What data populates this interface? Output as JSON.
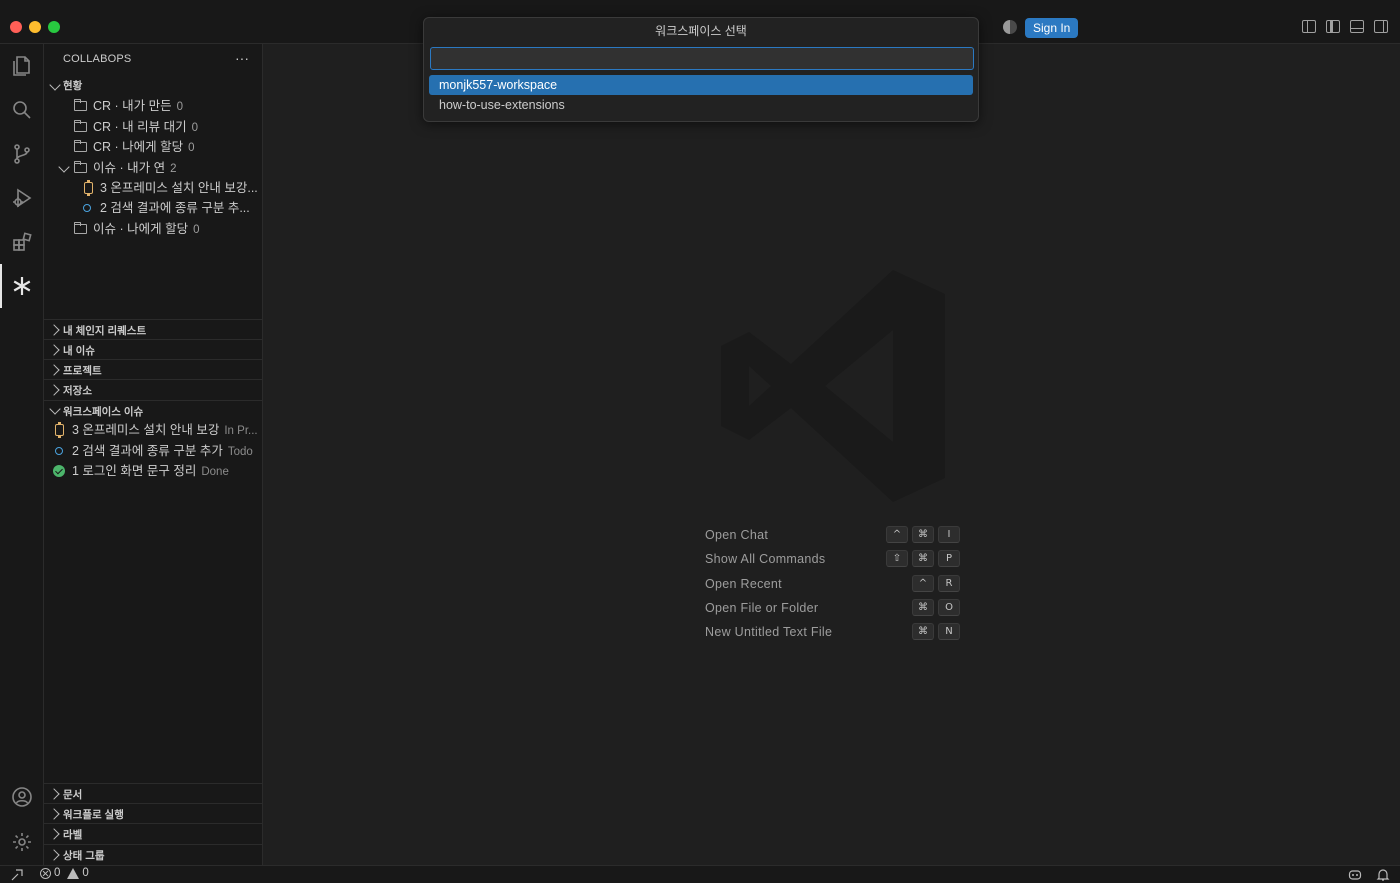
{
  "titlebar": {
    "sign_in_label": "Sign In"
  },
  "activity_bar": {
    "items": [
      {
        "icon": "files-icon"
      },
      {
        "icon": "search-icon"
      },
      {
        "icon": "source-control-icon"
      },
      {
        "icon": "run-debug-icon"
      },
      {
        "icon": "extensions-icon"
      },
      {
        "icon": "collabops-asterisk-icon",
        "active": true
      }
    ],
    "bottom": [
      {
        "icon": "account-icon"
      },
      {
        "icon": "gear-icon"
      }
    ]
  },
  "sidebar": {
    "title": "COLLABOPS",
    "more": "···",
    "status_group": {
      "title": "현황",
      "items": [
        {
          "label": "CR · 내가 만든",
          "count": "0"
        },
        {
          "label": "CR · 내 리뷰 대기",
          "count": "0"
        },
        {
          "label": "CR · 나에게 할당",
          "count": "0"
        },
        {
          "label": "이슈 · 내가 연",
          "count": "2"
        },
        {
          "label": "3  온프레미스 설치 안내 보강..."
        },
        {
          "label": "2  검색 결과에 종류 구분 추..."
        },
        {
          "label": "이슈 · 나에게 할당",
          "count": "0"
        }
      ]
    },
    "sections": [
      {
        "title": "내 체인지 리퀘스트"
      },
      {
        "title": "내 이슈"
      },
      {
        "title": "프로젝트"
      },
      {
        "title": "저장소"
      },
      {
        "title": "워크스페이스 이슈"
      }
    ],
    "workspace_issues": [
      {
        "label": "3  온프레미스 설치 안내 보강",
        "state": "In Pr..."
      },
      {
        "label": "2  검색 결과에 종류 구분 추가",
        "state": "Todo"
      },
      {
        "label": "1  로그인 화면 문구 정리",
        "state": "Done"
      }
    ],
    "bottom_sections": [
      {
        "title": "문서"
      },
      {
        "title": "워크플로 실행"
      },
      {
        "title": "라벨"
      },
      {
        "title": "상태 그룹"
      }
    ]
  },
  "quick_pick": {
    "title": "워크스페이스 선택",
    "input_value": "",
    "items": [
      "monjk557-workspace",
      "how-to-use-extensions"
    ]
  },
  "editor": {
    "shortcuts": [
      {
        "label": "Open Chat",
        "keys": [
          "^",
          "⌘",
          "I"
        ]
      },
      {
        "label": "Show All Commands",
        "keys": [
          "⇧",
          "⌘",
          "P"
        ]
      },
      {
        "label": "Open Recent",
        "keys": [
          "^",
          "R"
        ]
      },
      {
        "label": "Open File or Folder",
        "keys": [
          "⌘",
          "O"
        ]
      },
      {
        "label": "New Untitled Text File",
        "keys": [
          "⌘",
          "N"
        ]
      }
    ]
  },
  "statusbar": {
    "errors": "0",
    "warnings": "0"
  },
  "colors": {
    "accent": "#2b79c2",
    "selection": "#2670b0",
    "watch": "#e2b36b",
    "todo": "#4aa3df",
    "done": "#4cb56b"
  }
}
